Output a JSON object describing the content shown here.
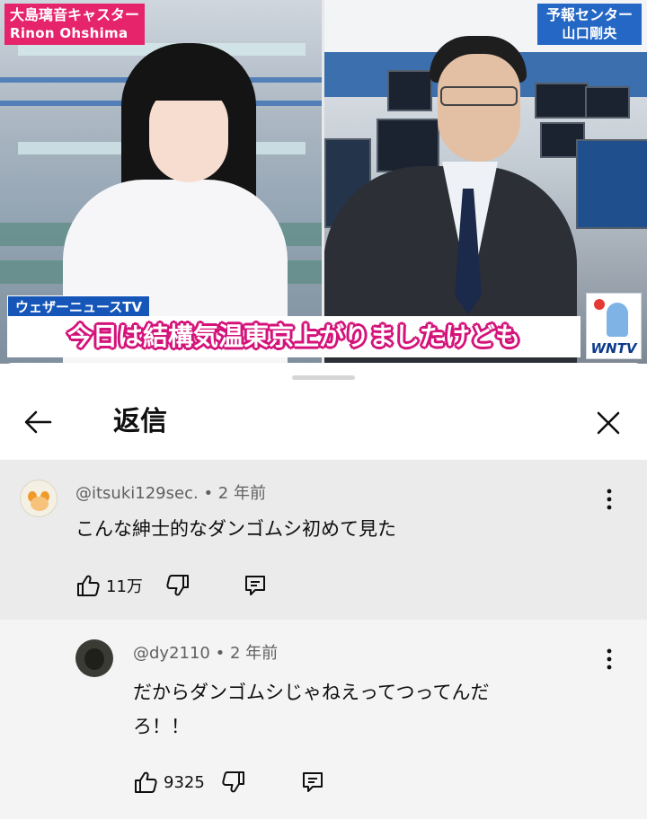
{
  "video": {
    "left_name_tag": {
      "line1": "大島璃音キャスター",
      "line2": "Rinon Ohshima"
    },
    "right_name_tag": {
      "line1": "予報センター",
      "line2": "山口剛央"
    },
    "channel_label": "ウェザーニュースTV",
    "caption": "今日は結構気温東京上がりましたけども",
    "logo_text": "WNTV"
  },
  "sheet": {
    "title": "返信"
  },
  "comments": [
    {
      "username": "@itsuki129sec.",
      "age": "2 年前",
      "text": "こんな紳士的なダンゴムシ初めて見た",
      "likes": "11万"
    },
    {
      "username": "@dy2110",
      "age": "2 年前",
      "text_line1": "だからダンゴムシじゃねえってつってんだ",
      "text_line2": "ろ！！",
      "likes": "9325"
    }
  ],
  "icons": {
    "back": "arrow-left-icon",
    "close": "close-icon",
    "more": "more-vert-icon",
    "like": "thumb-up-icon",
    "dislike": "thumb-down-icon",
    "reply": "comment-icon"
  },
  "colors": {
    "name_tag_pink": "#e6246c",
    "name_tag_blue": "#2467c5",
    "caption_outline": "#d4127a",
    "channel_blue": "#1556b8"
  }
}
